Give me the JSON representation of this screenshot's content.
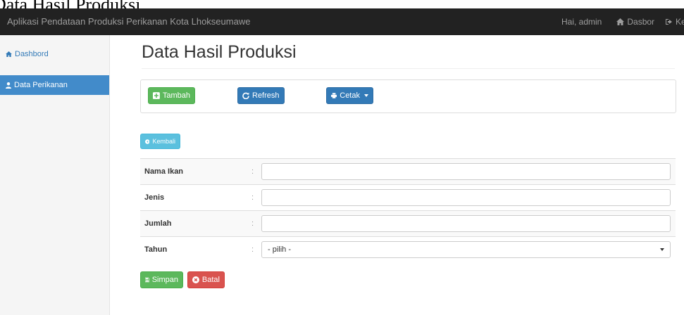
{
  "document_title": "Data Hasil Produksi",
  "navbar": {
    "brand": "Aplikasi Pendataan Produksi Perikanan Kota Lhokseumawe",
    "greeting": "Hai, admin",
    "dasbor_label": "Dasbor",
    "keluar_label": "Kelua"
  },
  "sidebar": {
    "items": [
      {
        "label": "Dashbord",
        "icon": "home-icon",
        "active": false
      },
      {
        "label": "Data Perikanan",
        "icon": "user-icon",
        "active": true
      }
    ]
  },
  "page": {
    "title": "Data Hasil Produksi"
  },
  "toolbar": {
    "tambah_label": "Tambah",
    "refresh_label": "Refresh",
    "cetak_label": "Cetak"
  },
  "kembali_label": "Kembali",
  "form": {
    "fields": [
      {
        "label": "Nama Ikan",
        "colon": ":",
        "value": ""
      },
      {
        "label": "Jenis",
        "colon": ":",
        "value": ""
      },
      {
        "label": "Jumlah",
        "colon": ":",
        "value": ""
      },
      {
        "label": "Tahun",
        "colon": ":",
        "selected": "- pilih -"
      }
    ],
    "simpan_label": "Simpan",
    "batal_label": "Batal"
  },
  "colors": {
    "navbar_bg": "#222222",
    "sidebar_active": "#428bca",
    "success": "#5cb85c",
    "primary": "#337ab7",
    "info": "#5bc0de",
    "danger": "#d9534f"
  }
}
